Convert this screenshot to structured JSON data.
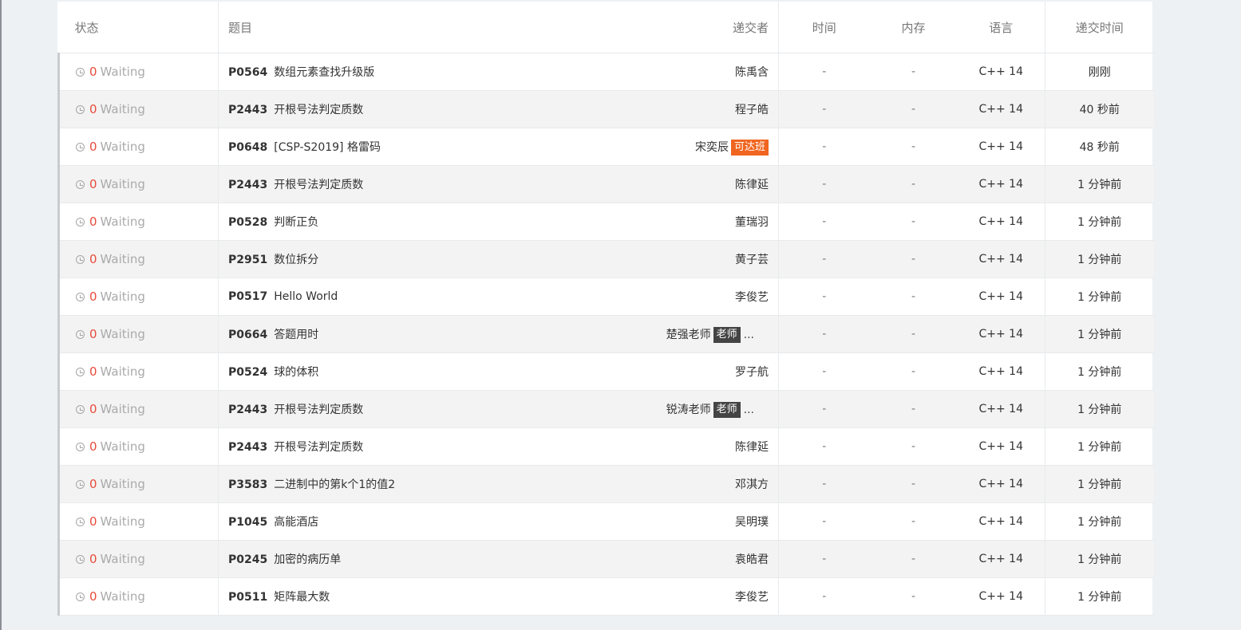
{
  "headers": {
    "status": "状态",
    "problem": "题目",
    "submitter": "递交者",
    "time": "时间",
    "memory": "内存",
    "language": "语言",
    "submit_time": "递交时间"
  },
  "colors": {
    "score_red": "#e74c3c",
    "badge_orange": "#f0651f",
    "badge_dark": "#444444"
  },
  "rows": [
    {
      "score": "0",
      "status": "Waiting",
      "pid": "P0564",
      "title": "数组元素查找升级版",
      "submitter": "陈禹含",
      "badge": "",
      "badge_color": "",
      "ellipsis": "",
      "time": "-",
      "memory": "-",
      "lang": "C++ 14",
      "when": "刚刚"
    },
    {
      "score": "0",
      "status": "Waiting",
      "pid": "P2443",
      "title": "开根号法判定质数",
      "submitter": "程子皓",
      "badge": "",
      "badge_color": "",
      "ellipsis": "",
      "time": "-",
      "memory": "-",
      "lang": "C++ 14",
      "when": "40 秒前"
    },
    {
      "score": "0",
      "status": "Waiting",
      "pid": "P0648",
      "title": "[CSP-S2019] 格雷码",
      "submitter": "宋奕辰",
      "badge": "可达班",
      "badge_color": "orange",
      "ellipsis": "",
      "time": "-",
      "memory": "-",
      "lang": "C++ 14",
      "when": "48 秒前"
    },
    {
      "score": "0",
      "status": "Waiting",
      "pid": "P2443",
      "title": "开根号法判定质数",
      "submitter": "陈律延",
      "badge": "",
      "badge_color": "",
      "ellipsis": "",
      "time": "-",
      "memory": "-",
      "lang": "C++ 14",
      "when": "1 分钟前"
    },
    {
      "score": "0",
      "status": "Waiting",
      "pid": "P0528",
      "title": "判断正负",
      "submitter": "董瑞羽",
      "badge": "",
      "badge_color": "",
      "ellipsis": "",
      "time": "-",
      "memory": "-",
      "lang": "C++ 14",
      "when": "1 分钟前"
    },
    {
      "score": "0",
      "status": "Waiting",
      "pid": "P2951",
      "title": "数位拆分",
      "submitter": "黄子芸",
      "badge": "",
      "badge_color": "",
      "ellipsis": "",
      "time": "-",
      "memory": "-",
      "lang": "C++ 14",
      "when": "1 分钟前"
    },
    {
      "score": "0",
      "status": "Waiting",
      "pid": "P0517",
      "title": "Hello World",
      "submitter": "李俊艺",
      "badge": "",
      "badge_color": "",
      "ellipsis": "",
      "time": "-",
      "memory": "-",
      "lang": "C++ 14",
      "when": "1 分钟前"
    },
    {
      "score": "0",
      "status": "Waiting",
      "pid": "P0664",
      "title": "答题用时",
      "submitter": "楚强老师",
      "badge": "老师",
      "badge_color": "dark",
      "ellipsis": "...",
      "time": "-",
      "memory": "-",
      "lang": "C++ 14",
      "when": "1 分钟前"
    },
    {
      "score": "0",
      "status": "Waiting",
      "pid": "P0524",
      "title": "球的体积",
      "submitter": "罗子航",
      "badge": "",
      "badge_color": "",
      "ellipsis": "",
      "time": "-",
      "memory": "-",
      "lang": "C++ 14",
      "when": "1 分钟前"
    },
    {
      "score": "0",
      "status": "Waiting",
      "pid": "P2443",
      "title": "开根号法判定质数",
      "submitter": "锐涛老师",
      "badge": "老师",
      "badge_color": "dark",
      "ellipsis": "...",
      "time": "-",
      "memory": "-",
      "lang": "C++ 14",
      "when": "1 分钟前"
    },
    {
      "score": "0",
      "status": "Waiting",
      "pid": "P2443",
      "title": "开根号法判定质数",
      "submitter": "陈律延",
      "badge": "",
      "badge_color": "",
      "ellipsis": "",
      "time": "-",
      "memory": "-",
      "lang": "C++ 14",
      "when": "1 分钟前"
    },
    {
      "score": "0",
      "status": "Waiting",
      "pid": "P3583",
      "title": "二进制中的第k个1的值2",
      "submitter": "邓淇方",
      "badge": "",
      "badge_color": "",
      "ellipsis": "",
      "time": "-",
      "memory": "-",
      "lang": "C++ 14",
      "when": "1 分钟前"
    },
    {
      "score": "0",
      "status": "Waiting",
      "pid": "P1045",
      "title": "高能酒店",
      "submitter": "吴明璞",
      "badge": "",
      "badge_color": "",
      "ellipsis": "",
      "time": "-",
      "memory": "-",
      "lang": "C++ 14",
      "when": "1 分钟前"
    },
    {
      "score": "0",
      "status": "Waiting",
      "pid": "P0245",
      "title": "加密的病历单",
      "submitter": "袁皓君",
      "badge": "",
      "badge_color": "",
      "ellipsis": "",
      "time": "-",
      "memory": "-",
      "lang": "C++ 14",
      "when": "1 分钟前"
    },
    {
      "score": "0",
      "status": "Waiting",
      "pid": "P0511",
      "title": "矩阵最大数",
      "submitter": "李俊艺",
      "badge": "",
      "badge_color": "",
      "ellipsis": "",
      "time": "-",
      "memory": "-",
      "lang": "C++ 14",
      "when": "1 分钟前"
    }
  ]
}
